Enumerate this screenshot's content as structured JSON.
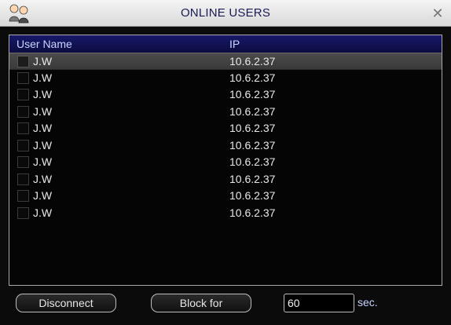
{
  "window": {
    "title": "ONLINE USERS",
    "close_glyph": "✕"
  },
  "table": {
    "columns": [
      "User Name",
      "IP"
    ],
    "rows": [
      {
        "user": "J.W",
        "ip": "10.6.2.37",
        "selected": true
      },
      {
        "user": "J.W",
        "ip": "10.6.2.37",
        "selected": false
      },
      {
        "user": "J.W",
        "ip": "10.6.2.37",
        "selected": false
      },
      {
        "user": "J.W",
        "ip": "10.6.2.37",
        "selected": false
      },
      {
        "user": "J.W",
        "ip": "10.6.2.37",
        "selected": false
      },
      {
        "user": "J.W",
        "ip": "10.6.2.37",
        "selected": false
      },
      {
        "user": "J.W",
        "ip": "10.6.2.37",
        "selected": false
      },
      {
        "user": "J.W",
        "ip": "10.6.2.37",
        "selected": false
      },
      {
        "user": "J.W",
        "ip": "10.6.2.37",
        "selected": false
      },
      {
        "user": "J.W",
        "ip": "10.6.2.37",
        "selected": false
      }
    ]
  },
  "controls": {
    "disconnect_label": "Disconnect",
    "block_label": "Block for",
    "block_seconds": "60",
    "seconds_unit": "sec."
  },
  "icons": {
    "title": "users-icon",
    "close": "close-icon"
  },
  "colors": {
    "title_text": "#1a1a55",
    "header_bg": "#18186a",
    "header_text": "#c8d4ff",
    "row_text": "#e8e8e8",
    "selected_row": "#4b4b4b"
  }
}
